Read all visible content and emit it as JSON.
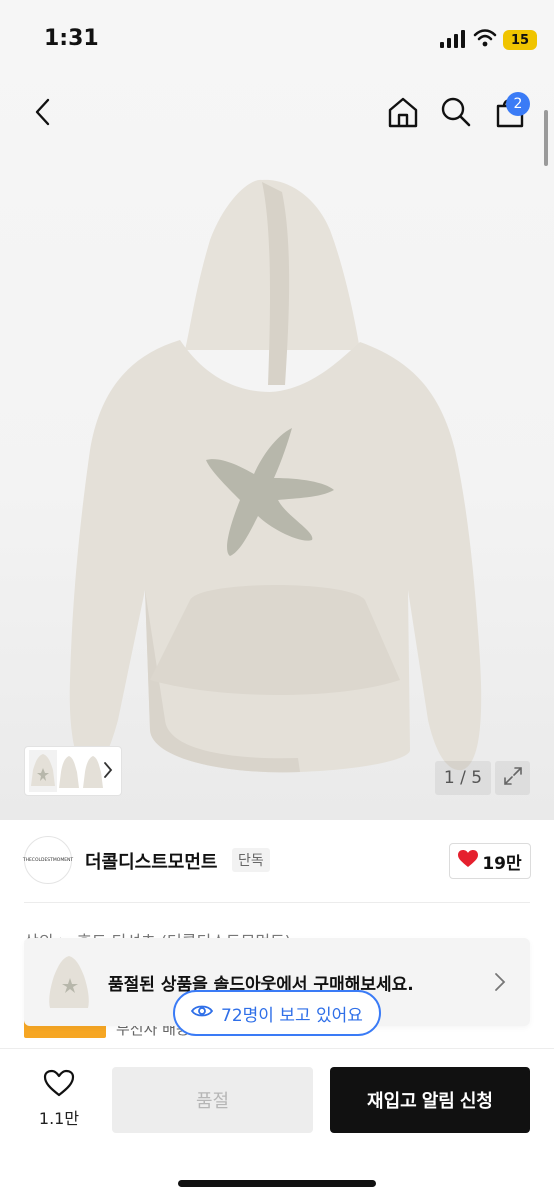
{
  "status_bar": {
    "time": "1:31",
    "battery": "15"
  },
  "header": {
    "cart_count": "2"
  },
  "gallery": {
    "page": "1 / 5"
  },
  "brand": {
    "logo_text": "THECOLDESTMOMENT",
    "name": "더콜디스트모먼트",
    "tag": "단독",
    "likes": "19만"
  },
  "product": {
    "breadcrumb_partial": "상의 > 후드 티셔츠 (더콜디스트모먼트)",
    "shipping_partial": "무신사 배송"
  },
  "soldout_banner": {
    "message": "품절된 상품을 솔드아웃에서 구매해보세요."
  },
  "viewers": {
    "label": "72명이 보고 있어요"
  },
  "bottom_bar": {
    "wish_count": "1.1만",
    "soldout_label": "품절",
    "restock_label": "재입고 알림 신청"
  },
  "colors": {
    "accent_blue": "#3a7bf6",
    "heart_red": "#e5202e",
    "primary_button": "#111111",
    "hoodie": "#e4e0d8",
    "starfish": "#b7b7ab"
  },
  "icons": [
    "back-arrow-icon",
    "home-icon",
    "search-icon",
    "cart-icon",
    "expand-icon",
    "chevron-right-icon",
    "heart-icon",
    "eye-icon"
  ]
}
